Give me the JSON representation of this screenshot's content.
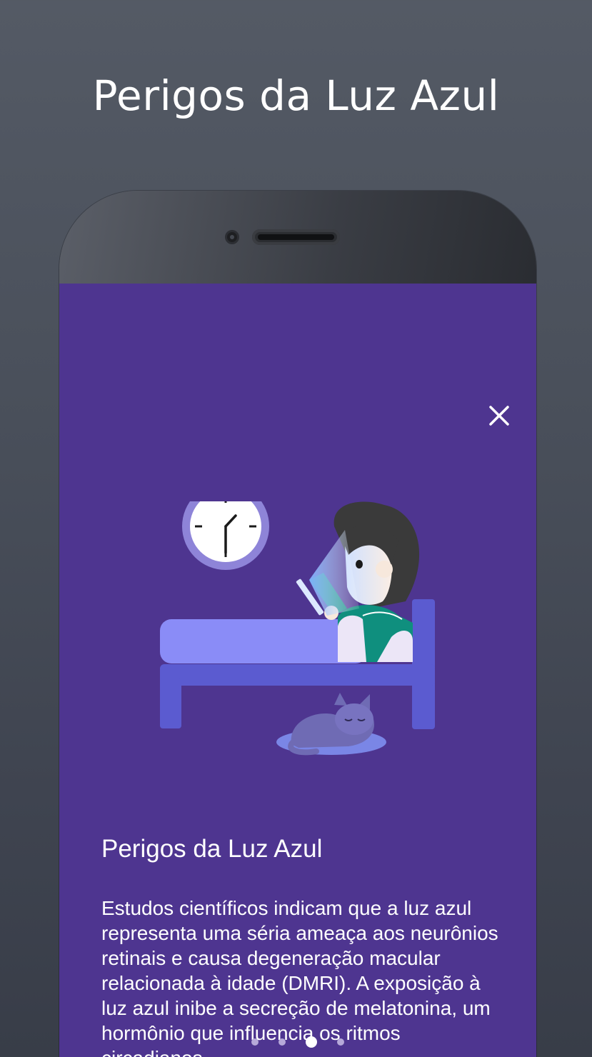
{
  "header": {
    "title": "Perigos da Luz Azul"
  },
  "card": {
    "title": "Perigos da Luz Azul",
    "body": "Estudos científicos indicam que a luz azul representa uma séria ameaça aos neurônios retinais e causa degeneração macular relacionada à idade (DMRI). A exposição à luz azul inibe a secreção de melatonina, um hormônio que influencia os ritmos circadianos.",
    "close_icon": "close-icon"
  },
  "pager": {
    "total": 4,
    "active_index": 2
  },
  "colors": {
    "background": "#494f5a",
    "screen": "#4e3590",
    "bed": "#8a8cf7",
    "bed_frame": "#5b5bd0",
    "clock_ring": "#8e84d8",
    "text": "#ffffff"
  }
}
